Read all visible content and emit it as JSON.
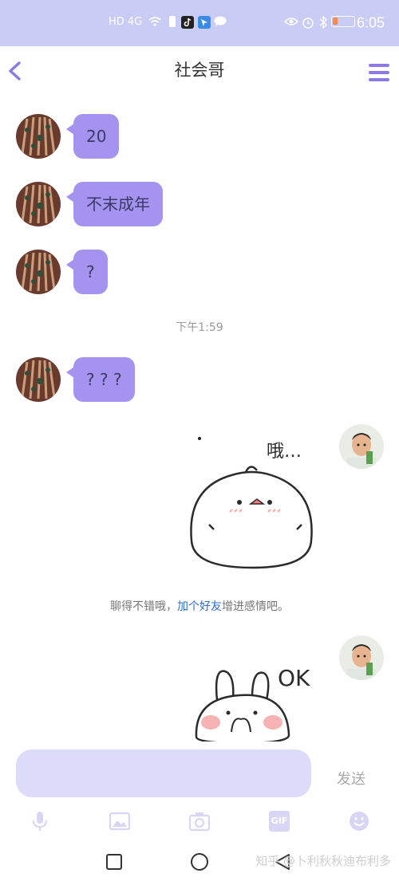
{
  "status_bar": {
    "network_text": "HD 4G",
    "time": "6:05",
    "icons": [
      "hd-icon",
      "signal-icon",
      "wifi-icon",
      "sim-icon",
      "tiktok-icon",
      "app-icon",
      "chat-icon",
      "eye-icon",
      "alarm-icon",
      "bluetooth-icon",
      "battery-icon"
    ]
  },
  "header": {
    "title": "社会哥",
    "back_icon": "chevron-left-icon",
    "menu_icon": "hamburger-menu-icon",
    "accent_color": "#8d7ae8"
  },
  "messages": [
    {
      "side": "left",
      "text": "20"
    },
    {
      "side": "left",
      "text": "不末成年"
    },
    {
      "side": "left",
      "text": "?"
    },
    {
      "side": "left",
      "text": "? ? ?"
    }
  ],
  "timestamp": "下午1:59",
  "sticker_1": {
    "caption": "哦…"
  },
  "system_message": {
    "prefix": "聊得不错哦，",
    "link": "加个好友",
    "suffix": "增进感情吧。"
  },
  "sticker_2": {
    "caption": "OK"
  },
  "input": {
    "placeholder": "",
    "send_label": "发送"
  },
  "toolbar": {
    "icons": [
      "microphone-icon",
      "image-icon",
      "camera-icon",
      "gif-icon",
      "emoji-icon"
    ],
    "gif_label": "GIF"
  },
  "watermark": "知乎 @卜利秋秋迪布利多",
  "colors": {
    "status_bar_bg": "#c9cdf5",
    "bubble_bg": "#a593f0",
    "input_bg": "#dcdcfa"
  }
}
